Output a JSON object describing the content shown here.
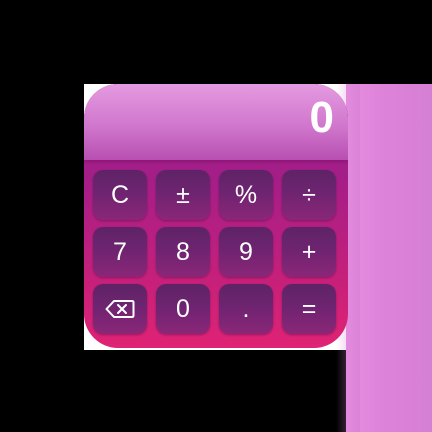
{
  "display": {
    "value": "0"
  },
  "keys": {
    "row1": [
      "C",
      "±",
      "%",
      "÷"
    ],
    "row2": [
      "7",
      "8",
      "9",
      "+"
    ],
    "row3": [
      "backspace-icon",
      "0",
      ".",
      "="
    ]
  },
  "colors": {
    "background": "#000000",
    "display_top": "#e59ae0",
    "display_bottom": "#b84fb2",
    "body_top": "#9e1f8e",
    "body_bottom": "#e02375",
    "key_top": "#5e2366",
    "key_bottom": "#8b2678",
    "text": "#ffffff",
    "side_panel": "#d57fd4"
  }
}
